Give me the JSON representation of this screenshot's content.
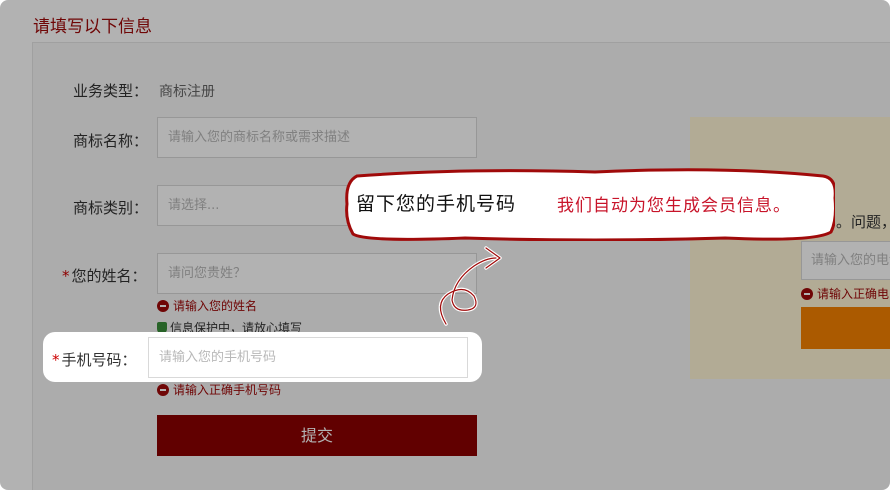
{
  "page": {
    "title": "请填写以下信息"
  },
  "form": {
    "business_type_label": "业务类型：",
    "business_type_value": "商标注册",
    "trademark_name_label": "商标名称：",
    "trademark_name_placeholder": "请输入您的商标名称或需求描述",
    "trademark_class_label": "商标类别：",
    "trademark_class_placeholder": "请选择...",
    "name_required_mark": "*",
    "name_label": "您的姓名：",
    "name_placeholder": "请问您贵姓？",
    "name_error": "请输入您的姓名",
    "privacy_note": "信息保护中，请放心填写",
    "phone_required_mark": "*",
    "phone_label": "手机号码：",
    "phone_placeholder": "请输入您的手机号码",
    "phone_error": "请输入正确手机号码",
    "submit_label": "提交"
  },
  "side_panel": {
    "text_fragment": "。问题，只",
    "input_placeholder": "请输入您的电话号码",
    "error_fragment": "请输入正确电"
  },
  "callout": {
    "text": "留下您的手机号码",
    "text_red": "我们自动为您生成会员信息。"
  },
  "colors": {
    "brand_red": "#8b0000",
    "error_red": "#a00a0a",
    "side_button_orange": "#f58200",
    "side_bg": "#fff5d6"
  }
}
